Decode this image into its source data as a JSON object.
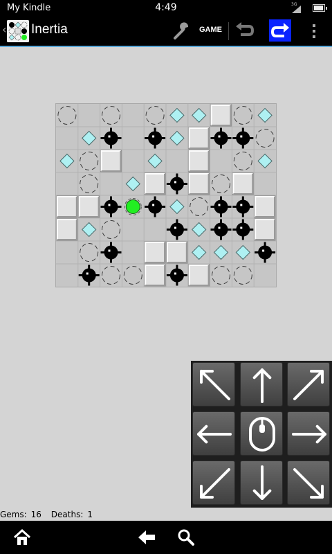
{
  "status_bar": {
    "carrier": "My Kindle",
    "time": "4:49",
    "network": "3G",
    "battery_level": 0.85
  },
  "action_bar": {
    "back_icon": "chevron-left-icon",
    "title": "Inertia",
    "settings_icon": "wrench-icon",
    "game_label": "GAME",
    "undo_icon": "undo-icon",
    "redo_icon": "redo-icon",
    "overflow_icon": "overflow-menu-icon",
    "accent_color": "#5aa8d8",
    "redo_bg_color": "#0a24ff"
  },
  "board": {
    "rows": 8,
    "cols": 10,
    "legend": {
      ".": "blank",
      "G": "gem",
      "M": "mine",
      "S": "stop",
      "W": "wall",
      "P": "player"
    },
    "grid": [
      "S.S.SGGWSG",
      ".GM.MGWMMS",
      "GSW.G.W.SG",
      ".S.GWMWSW.",
      "WWMPMGSMMW",
      "WGS..MGMMW",
      ".SM.WWGGGM",
      ".MSSWMWSS."
    ],
    "colors": {
      "gem": "#aef0f2",
      "player": "#22ee22",
      "mine": "#000000",
      "wall": "#e2e2e2",
      "background": "#c6c6c6",
      "grid_line": "#b2b2b2"
    }
  },
  "controls": {
    "buttons": [
      {
        "dir": "up-left",
        "icon": "arrow-up-left-icon"
      },
      {
        "dir": "up",
        "icon": "arrow-up-icon"
      },
      {
        "dir": "up-right",
        "icon": "arrow-up-right-icon"
      },
      {
        "dir": "left",
        "icon": "arrow-left-icon"
      },
      {
        "dir": "center",
        "icon": "mouse-icon"
      },
      {
        "dir": "right",
        "icon": "arrow-right-icon"
      },
      {
        "dir": "down-left",
        "icon": "arrow-down-left-icon"
      },
      {
        "dir": "down",
        "icon": "arrow-down-icon"
      },
      {
        "dir": "down-right",
        "icon": "arrow-down-right-icon"
      }
    ]
  },
  "game_status": {
    "gems_label": "Gems:",
    "gems": 16,
    "deaths_label": "Deaths:",
    "deaths": 1
  },
  "nav_bar": {
    "home_icon": "home-icon",
    "back_icon": "back-arrow-icon",
    "search_icon": "search-icon"
  }
}
